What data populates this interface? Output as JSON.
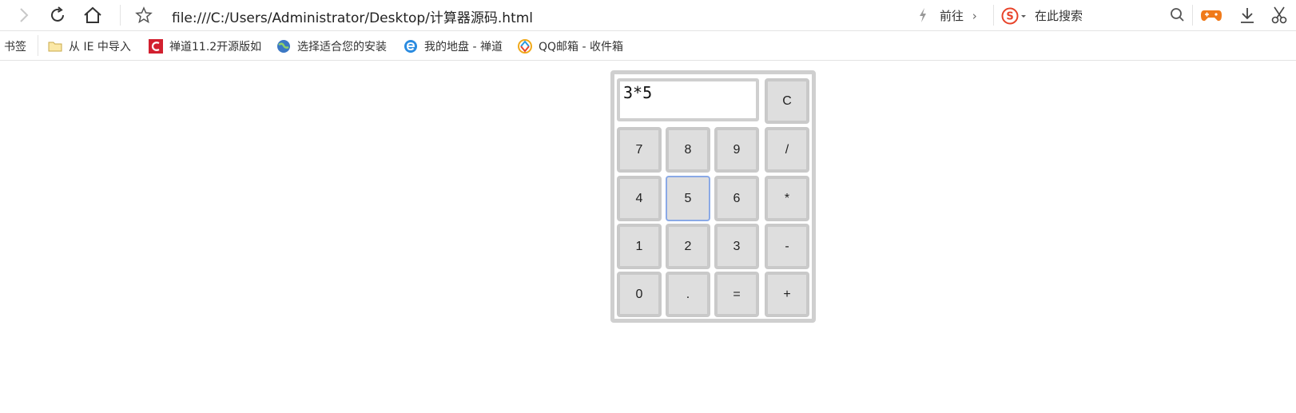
{
  "toolbar": {
    "url": "file:///C:/Users/Administrator/Desktop/计算器源码.html",
    "goto_label": "前往",
    "search_placeholder": "在此搜索"
  },
  "bookmarks": {
    "label": "书签",
    "items": [
      {
        "label": "从 IE 中导入",
        "icon": "folder-icon"
      },
      {
        "label": "禅道11.2开源版如",
        "icon": "zentao-icon"
      },
      {
        "label": "选择适合您的安装",
        "icon": "globe-icon"
      },
      {
        "label": "我的地盘 - 禅道",
        "icon": "browser-e-icon"
      },
      {
        "label": "QQ邮箱 - 收件箱",
        "icon": "qq-mail-icon"
      }
    ]
  },
  "calculator": {
    "display": "3*5",
    "clear_label": "C",
    "keys": [
      [
        "7",
        "8",
        "9",
        "/"
      ],
      [
        "4",
        "5",
        "6",
        "*"
      ],
      [
        "1",
        "2",
        "3",
        "-"
      ],
      [
        "0",
        ".",
        "=",
        "+"
      ]
    ]
  },
  "colors": {
    "accent_orange": "#f07a1a",
    "sogou_red": "#e8432a",
    "key_bg": "#dedede",
    "key_border": "#c9c9c9",
    "focus_border": "#8aa9e6"
  }
}
